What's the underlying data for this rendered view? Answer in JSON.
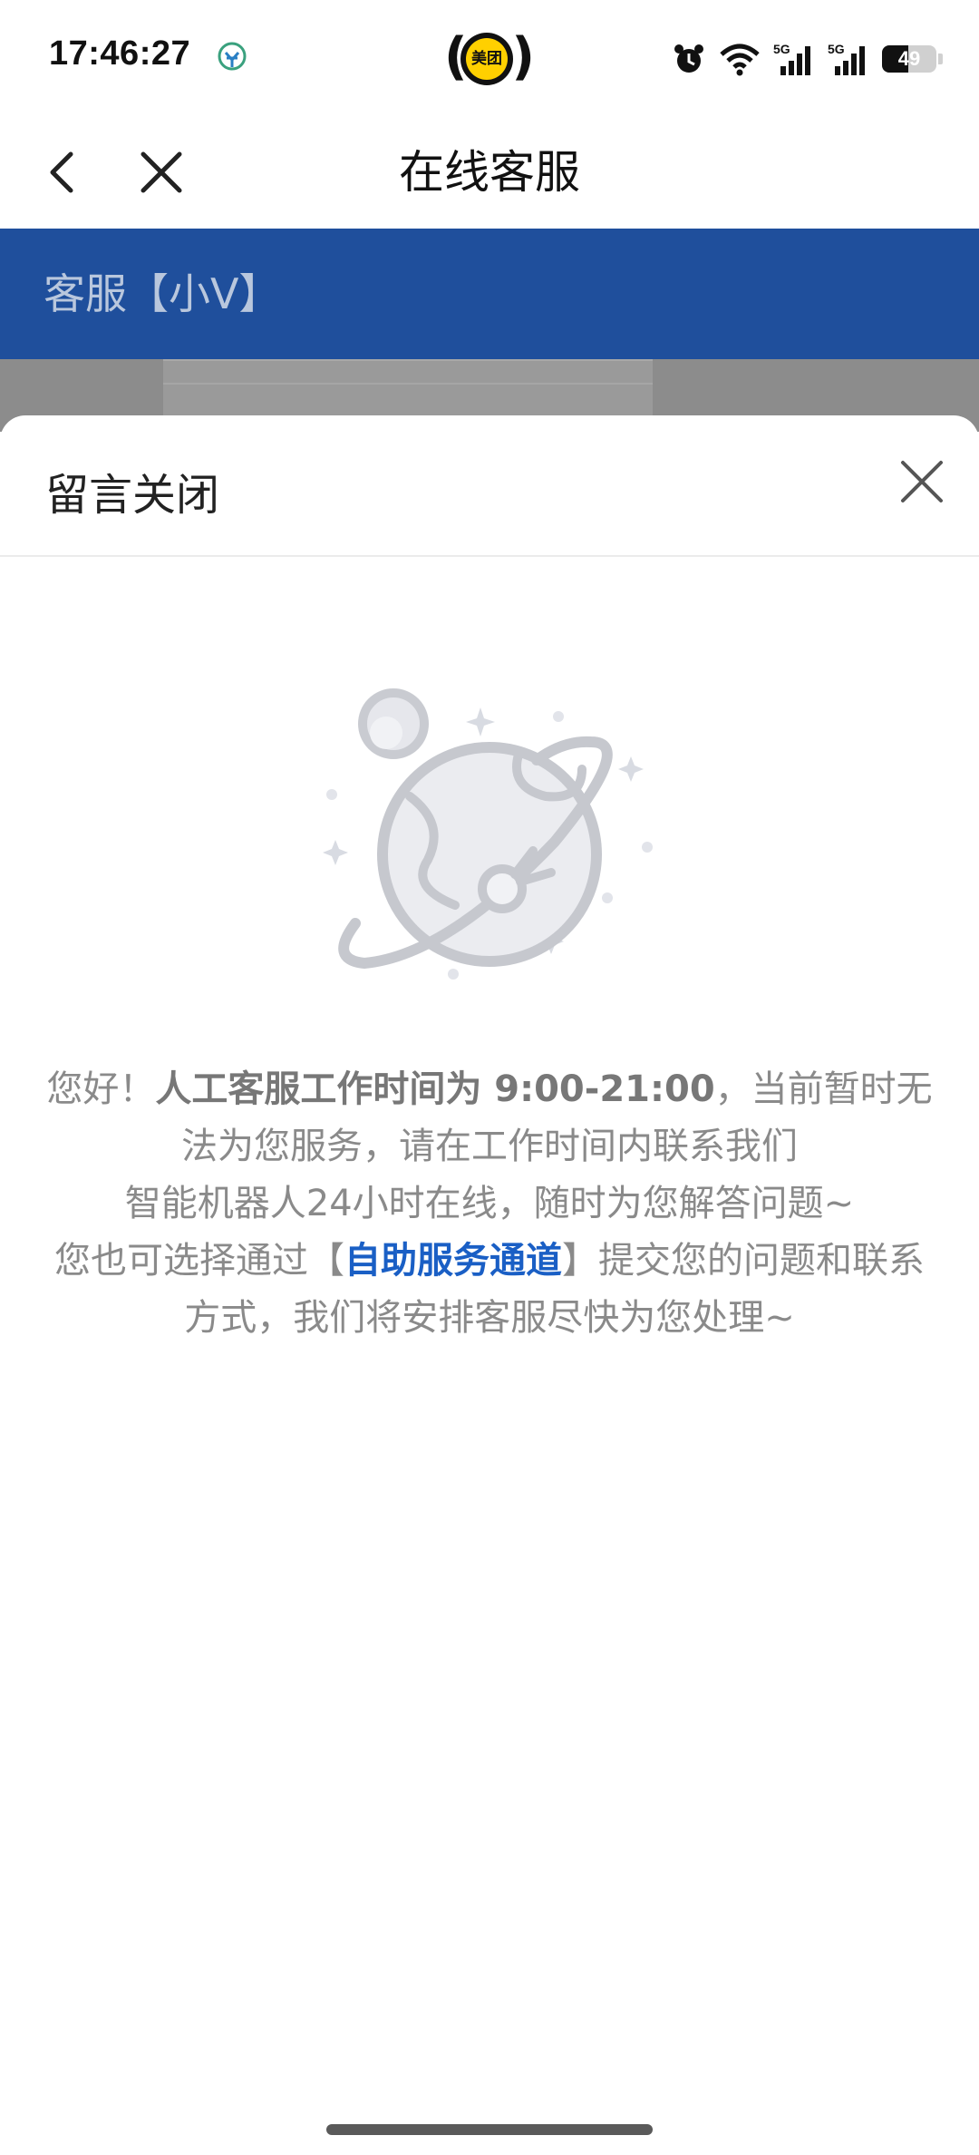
{
  "status_bar": {
    "time": "17:46:27",
    "center_app": "美团",
    "battery": "49",
    "battery_fraction": 0.49,
    "icons": [
      "alarm-icon",
      "wifi-icon",
      "5g-signal-icon",
      "5g-signal-icon",
      "battery-icon"
    ]
  },
  "nav": {
    "title": "在线客服",
    "back_icon": "chevron-left-icon",
    "close_icon": "close-icon"
  },
  "chat_header": {
    "title": "客服【小V】"
  },
  "sheet": {
    "title": "留言关闭",
    "close_icon": "close-icon",
    "illustration": "planet-empty-state-icon",
    "notice": {
      "greeting": "您好！",
      "hours": "人工客服工作时间为 9:00-21:00",
      "after_hours": "，当前暂时无法为您服务，请在工作时间内联系我们",
      "line2": "智能机器人24小时在线，随时为您解答问题~",
      "line3_pre": "您也可选择通过【",
      "channel_link": "自助服务通道",
      "line3_post": "】提交您的问题和联系方式，我们将安排客服尽快为您处理~"
    }
  },
  "colors": {
    "header_blue": "#1F4F9C",
    "link_blue": "#1a5fc5",
    "meituan_yellow": "#FFD000"
  }
}
